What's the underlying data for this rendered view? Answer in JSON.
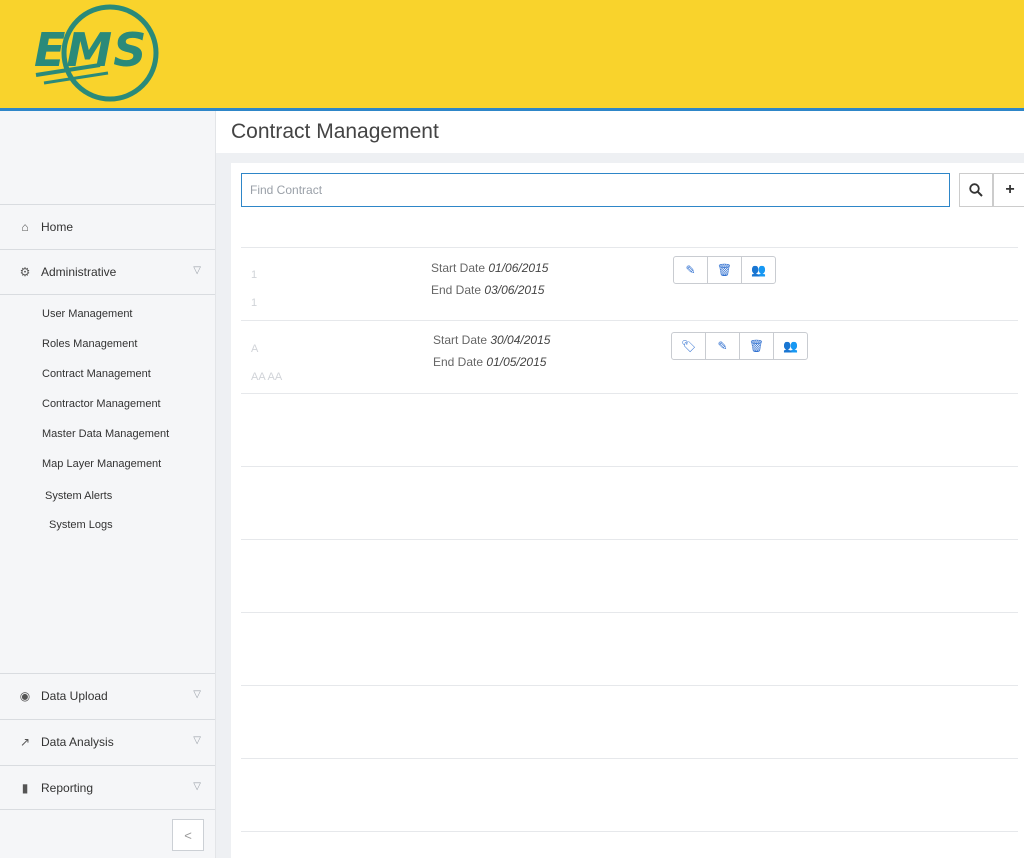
{
  "header": {
    "logo_text": "EMS"
  },
  "page": {
    "title": "Contract Management"
  },
  "search": {
    "placeholder": "Find Contract"
  },
  "sidebar": {
    "items": [
      {
        "label": "Home",
        "icon": "home-icon"
      },
      {
        "label": "Administrative",
        "icon": "cogs-icon"
      },
      {
        "label": "Data Upload",
        "icon": "globe-icon"
      },
      {
        "label": "Data Analysis",
        "icon": "line-chart-icon"
      },
      {
        "label": "Reporting",
        "icon": "bar-chart-icon"
      }
    ],
    "sub_items": [
      "User Management",
      "Roles Management",
      "Contract Management",
      "Contractor Management",
      "Master Data Management",
      "Map Layer Management",
      "System Alerts",
      "System Logs"
    ],
    "collapse_glyph": "<"
  },
  "contracts": [
    {
      "start_label": "Start Date",
      "start": "01/06/2015",
      "end_label": "End Date",
      "end": "03/06/2015",
      "name_line1": "1",
      "name_line2": "1"
    },
    {
      "start_label": "Start Date",
      "start": "30/04/2015",
      "end_label": "End Date",
      "end": "01/05/2015",
      "name_line1": "A",
      "name_line2": "AA AA"
    }
  ],
  "colors": {
    "header_bg": "#f9d32c",
    "accent_blue": "#2e86c8",
    "logo_teal": "#2a8a7a",
    "action_icon": "#2e6fd0"
  }
}
